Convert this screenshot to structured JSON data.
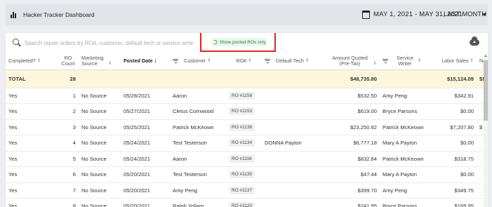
{
  "header": {
    "title": "Hacker Tracker Dashboard",
    "date_range": "MAY 1, 2021 - MAY 31, 2021",
    "period": "LAST MONTH"
  },
  "search": {
    "placeholder": "Search repair orders by RO#, customer, default tech or service writer"
  },
  "toggle": {
    "label": "Show posted ROs only",
    "on": true,
    "accent": "#2ea84f"
  },
  "columns": {
    "completed": "Completed?",
    "ro_count": "RO Count",
    "marketing_source": "Marketing Source",
    "posted_date": "Posted Date",
    "customer": "Customer",
    "ro_num": "RO#",
    "default_tech": "Default Tech",
    "amount_quoted": "Amount Quoted (Pre-Tax)",
    "service_writer": "Service Writer",
    "labor_sales": "Labor Sales",
    "non_labor": "Non-L"
  },
  "total": {
    "label": "TOTAL",
    "ro_count": "28",
    "amount_quoted": "$48,735.80",
    "labor_sales": "$15,124.09",
    "non_labor": "$!"
  },
  "rows": [
    {
      "completed": "Yes",
      "count": "1",
      "source": "No Source",
      "date": "05/28/2021",
      "customer": "Aaron",
      "ro": "RO #1158",
      "tech": "",
      "amount": "$532.50",
      "writer": "Amy Peng",
      "labor": "$342.91",
      "non_labor": ""
    },
    {
      "completed": "Yes",
      "count": "2",
      "source": "No Source",
      "date": "05/27/2021",
      "customer": "Cletus Cornwood",
      "ro": "RO #1153",
      "tech": "",
      "amount": "$619.00",
      "writer": "Bryce Parsons",
      "labor": "$0.00",
      "non_labor": ""
    },
    {
      "completed": "Yes",
      "count": "3",
      "source": "No Source",
      "date": "05/25/2021",
      "customer": "Patrick McKeown",
      "ro": "RO #1138",
      "tech": "",
      "amount": "$23,250.92",
      "writer": "Patrick McKeown",
      "labor": "$7,207.80",
      "non_labor": "$"
    },
    {
      "completed": "Yes",
      "count": "4",
      "source": "No Source",
      "date": "05/24/2021",
      "customer": "Test Testerson",
      "ro": "RO #1134",
      "tech": "DONNA Payton",
      "amount": "$6,777.18",
      "writer": "Mary A Payton",
      "labor": "$0.00",
      "non_labor": ""
    },
    {
      "completed": "Yes",
      "count": "5",
      "source": "No Source",
      "date": "05/24/2021",
      "customer": "Aaron",
      "ro": "RO #1116",
      "tech": "",
      "amount": "$832.84",
      "writer": "Patrick McKeown",
      "labor": "$318.75",
      "non_labor": ""
    },
    {
      "completed": "Yes",
      "count": "6",
      "source": "No Source",
      "date": "05/20/2021",
      "customer": "Test Testerson",
      "ro": "RO #1135",
      "tech": "",
      "amount": "$47.44",
      "writer": "Mary A Payton",
      "labor": "$0.00",
      "non_labor": ""
    },
    {
      "completed": "Yes",
      "count": "7",
      "source": "No Source",
      "date": "05/20/2021",
      "customer": "Amy Peng",
      "ro": "RO #1137",
      "tech": "",
      "amount": "$399.70",
      "writer": "Amy Peng",
      "labor": "$349.75",
      "non_labor": ""
    },
    {
      "completed": "Yes",
      "count": "8",
      "source": "No Source",
      "date": "05/20/2021",
      "customer": "Ralph Yollam",
      "ro": "RO #1120",
      "tech": "",
      "amount": "$241.95",
      "writer": "Bryce Parsons",
      "labor": "$169.95",
      "non_labor": ""
    }
  ],
  "icons": {
    "brand": "bar-chart-icon",
    "calendar": "calendar-icon",
    "period_caret": "chevron-down-icon",
    "search": "search-icon",
    "export": "cloud-upload-icon",
    "filter": "filter-icon",
    "sort": "sort-icon"
  }
}
